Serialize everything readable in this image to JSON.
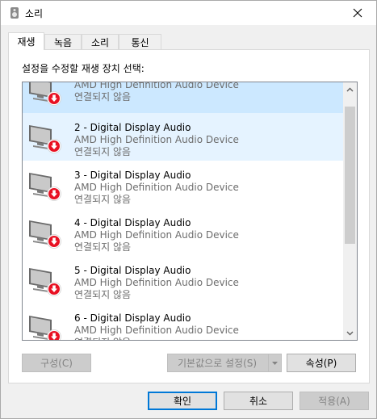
{
  "window": {
    "title": "소리"
  },
  "tabs": [
    {
      "label": "재생",
      "active": true
    },
    {
      "label": "녹음"
    },
    {
      "label": "소리"
    },
    {
      "label": "통신"
    }
  ],
  "instruction": "설정을 수정할 재생 장치 선택:",
  "devices": [
    {
      "name": "",
      "driver": "AMD High Definition Audio Device",
      "status": "연결되지 않음",
      "state": "selected"
    },
    {
      "name": "2 - Digital Display Audio",
      "driver": "AMD High Definition Audio Device",
      "status": "연결되지 않음",
      "state": "hover"
    },
    {
      "name": "3 - Digital Display Audio",
      "driver": "AMD High Definition Audio Device",
      "status": "연결되지 않음",
      "state": ""
    },
    {
      "name": "4 - Digital Display Audio",
      "driver": "AMD High Definition Audio Device",
      "status": "연결되지 않음",
      "state": ""
    },
    {
      "name": "5 - Digital Display Audio",
      "driver": "AMD High Definition Audio Device",
      "status": "연결되지 않음",
      "state": ""
    },
    {
      "name": "6 - Digital Display Audio",
      "driver": "AMD High Definition Audio Device",
      "status": "연결되지 않음",
      "state": ""
    }
  ],
  "buttons": {
    "configure": "구성(C)",
    "set_default": "기본값으로 설정(S)",
    "properties": "속성(P)",
    "ok": "확인",
    "cancel": "취소",
    "apply": "적용(A)"
  },
  "icons": {
    "device": "speaker-disconnected-icon",
    "status_badge": "red-down-arrow-icon"
  },
  "colors": {
    "selected_row": "#cce8ff",
    "hover_row": "#e5f3ff",
    "badge_red": "#e81123",
    "default_button_border": "#0078d7"
  }
}
